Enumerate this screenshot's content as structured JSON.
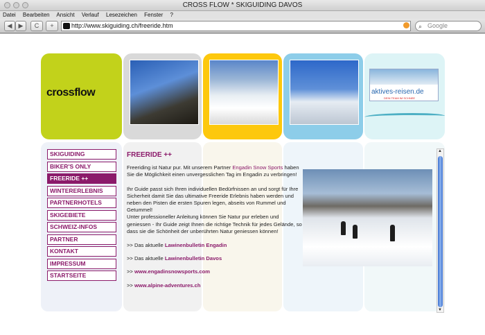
{
  "window": {
    "title": "CROSS FLOW * SKIGUIDING DAVOS"
  },
  "menu": [
    "Datei",
    "Bearbeiten",
    "Ansicht",
    "Verlauf",
    "Lesezeichen",
    "Fenster",
    "?"
  ],
  "toolbar": {
    "back": "◀",
    "forward": "▶",
    "reload": "C",
    "add": "+",
    "url": "http://www.skiguiding.ch/freeride.htm",
    "search_placeholder": "Google"
  },
  "header": {
    "logo": "crossflow",
    "partner_logo": "aktives-reisen.de",
    "partner_tagline": "DEIN TEAM IM SCHNEE"
  },
  "nav": [
    {
      "label": "SKIGUIDING",
      "active": false
    },
    {
      "label": "BIKER'S ONLY",
      "active": false
    },
    {
      "label": "FREERIDE ++",
      "active": true
    },
    {
      "label": "WINTERERLEBNIS",
      "active": false
    },
    {
      "label": "PARTNERHOTELS",
      "active": false
    },
    {
      "label": "SKIGEBIETE",
      "active": false
    },
    {
      "label": "SCHWEIZ-INFOS",
      "active": false
    },
    {
      "label": "PARTNER",
      "active": false
    },
    {
      "label": "KONTAKT",
      "active": false
    },
    {
      "label": "IMPRESSUM",
      "active": false
    },
    {
      "label": "STARTSEITE",
      "active": false
    }
  ],
  "content": {
    "heading": "FREERIDE ++",
    "intro_prefix": "Freeriding ist Natur pur. Mit unserem Partner ",
    "intro_link": "Engadin Snow Sports",
    "intro_suffix": " haben Sie die Möglichkeit einen unvergesslichen Tag im Engadin zu verbringen!",
    "para2": "Ihr Guide passt sich Ihren individuellen Bedürfnissen an und sorgt für Ihre Sicherheit damit Sie das ultimative Freeride Erlebnis haben werden und neben den Pisten die ersten Spuren legen, abseits von Rummel und Getummel!",
    "para3": "Unter professioneller Anleitung können Sie Natur pur erleben und geniessen - Ihr Guide zeigt Ihnen die richtige Technik für jedes Gelände, so dass sie die Schönheit der unberührten Natur geniessen können!",
    "bulletin_engadin_prefix": ">> Das aktuelle ",
    "bulletin_engadin_link": "Lawinenbulletin Engadin",
    "bulletin_davos_prefix": ">> Das aktuelle ",
    "bulletin_davos_link": "Lawinenbulletin Davos",
    "link1_prefix": ">> ",
    "link1": "www.engadinsnowsports.com",
    "link2_prefix": ">> ",
    "link2": "www.alpine-adventures.ch"
  },
  "colors": {
    "accent": "#8b1a6a",
    "lime": "#c2d21b",
    "yellow": "#fdc80d",
    "sky": "#8dcde9"
  }
}
